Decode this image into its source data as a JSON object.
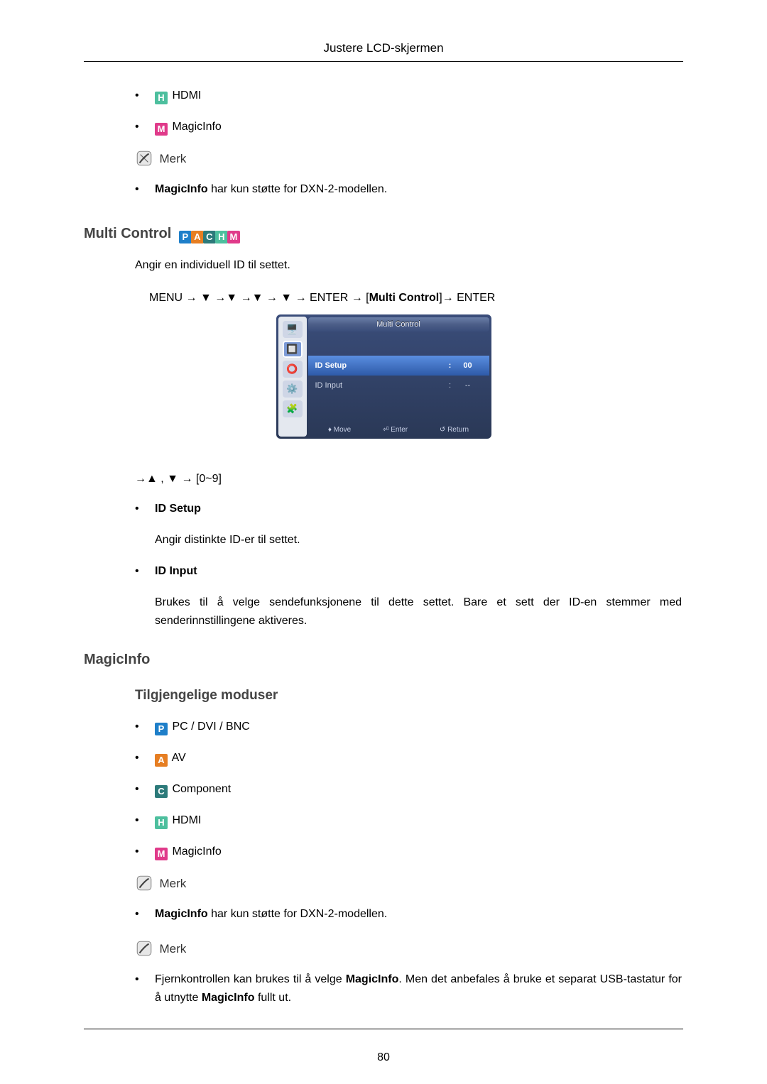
{
  "header": {
    "title": "Justere LCD-skjermen"
  },
  "modes1": {
    "hdmi_label": "HDMI",
    "magicinfo_label": "MagicInfo"
  },
  "note": {
    "label": "Merk"
  },
  "note1_item": {
    "bold": "MagicInfo",
    "rest": " har kun støtte for DXN-2-modellen."
  },
  "multi_control": {
    "heading": "Multi Control",
    "intro": "Angir en individuell ID til settet.",
    "path_prefix": "MENU → ▼ →▼ →▼ → ▼ → ENTER → [",
    "path_bold": "Multi Control",
    "path_suffix": "]→ ENTER",
    "nav": "→▲ , ▼ → [0~9]",
    "id_setup": "ID Setup",
    "id_setup_desc": "Angir distinkte ID-er til settet.",
    "id_input": "ID Input",
    "id_input_desc": "Brukes til å velge sendefunksjonene til dette settet. Bare et sett der ID-en stemmer med senderinnstillingene aktiveres."
  },
  "osd": {
    "title": "Multi Control",
    "row1_label": "ID Setup",
    "row1_value": "00",
    "row2_label": "ID Input",
    "row2_value": "--",
    "footer_move": "Move",
    "footer_enter": "Enter",
    "footer_return": "Return"
  },
  "magicinfo_section": {
    "heading": "MagicInfo",
    "subheading": "Tilgjengelige moduser",
    "modes": {
      "pc": "PC / DVI / BNC",
      "av": "AV",
      "component": "Component",
      "hdmi": "HDMI",
      "magicinfo": "MagicInfo"
    }
  },
  "note2_item": {
    "bold": "MagicInfo",
    "rest": " har kun støtte for DXN-2-modellen."
  },
  "note3_item": {
    "p1a": "Fjernkontrollen kan brukes til å velge ",
    "p1b": "MagicInfo",
    "p1c": ". Men det anbefales å bruke et separat USB-tastatur for å utnytte ",
    "p1d": "MagicInfo",
    "p1e": " fullt ut."
  },
  "pagenum": "80"
}
